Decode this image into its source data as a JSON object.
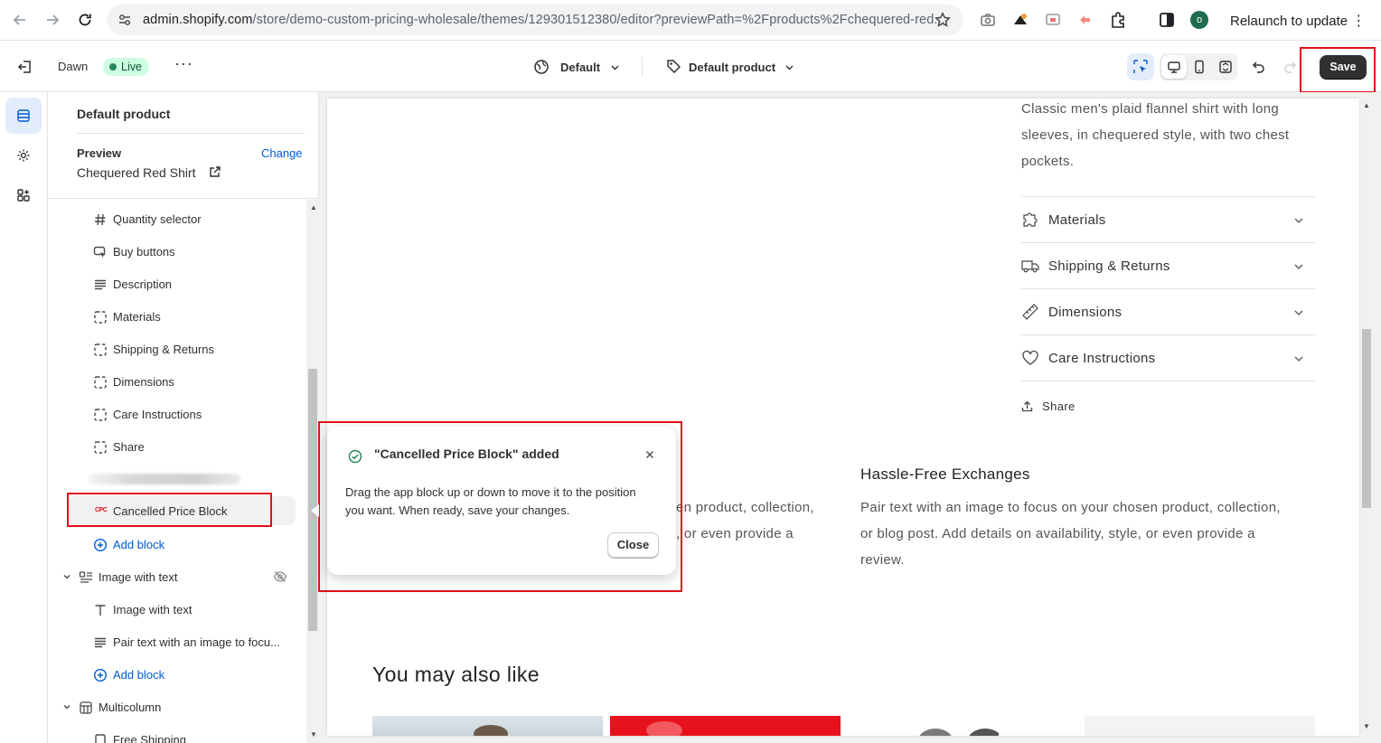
{
  "browser": {
    "url_host": "admin.shopify.com",
    "url_path": "/store/demo-custom-pricing-wholesale/themes/129301512380/editor?previewPath=%2Fproducts%2Fchequered-red...",
    "profile_initial": "o",
    "relaunch_label": "Relaunch to update"
  },
  "topbar": {
    "theme_name": "Dawn",
    "live_badge": "Live",
    "template_select": "Default",
    "product_select": "Default product",
    "save_label": "Save"
  },
  "sidebar": {
    "title": "Default product",
    "preview_label": "Preview",
    "change_link": "Change",
    "preview_product": "Chequered Red Shirt",
    "items": [
      {
        "label": "Quantity selector",
        "icon": "hash-icon"
      },
      {
        "label": "Buy buttons",
        "icon": "cursor-click-icon"
      },
      {
        "label": "Description",
        "icon": "text-align-icon"
      },
      {
        "label": "Materials",
        "icon": "dashed-square-icon"
      },
      {
        "label": "Shipping & Returns",
        "icon": "dashed-square-icon"
      },
      {
        "label": "Dimensions",
        "icon": "dashed-square-icon"
      },
      {
        "label": "Care Instructions",
        "icon": "dashed-square-icon"
      },
      {
        "label": "Share",
        "icon": "dashed-square-icon"
      }
    ],
    "app_block_label": "Cancelled Price Block",
    "app_block_badge": "CPC",
    "add_block_1": "Add block",
    "section_image_with_text": "Image with text",
    "iwt_children": [
      {
        "label": "Image with text",
        "icon": "text-T-icon"
      },
      {
        "label": "Pair text with an image to focu...",
        "icon": "text-align-icon"
      }
    ],
    "add_block_2": "Add block",
    "section_multicolumn": "Multicolumn",
    "multicolumn_child": "Free Shipping"
  },
  "preview": {
    "description": [
      "Classic men's plaid flannel shirt with long",
      "sleeves, in chequered style, with two chest",
      "pockets."
    ],
    "accordions": [
      {
        "label": "Materials",
        "icon": "puzzle-icon"
      },
      {
        "label": "Shipping & Returns",
        "icon": "truck-icon"
      },
      {
        "label": "Dimensions",
        "icon": "ruler-icon"
      },
      {
        "label": "Care Instructions",
        "icon": "heart-icon"
      }
    ],
    "share_label": "Share",
    "col2_heading": "Hassle-Free Exchanges",
    "col2_lines": [
      "Pair text with an image to focus on your chosen product, collection,",
      "or blog post. Add details on availability, style, or even provide a",
      "review."
    ],
    "col1_lines": [
      "en product, collection,",
      ", or even provide a"
    ],
    "related_heading": "You may also like"
  },
  "toast": {
    "title": "\"Cancelled Price Block\" added",
    "body_line1": "Drag the app block up or down to move it to the position",
    "body_line2": "you want. When ready, save your changes.",
    "close_label": "Close"
  },
  "colors": {
    "highlight_red": "#e0101b",
    "link_blue": "#005bd3",
    "live_green": "#29845a",
    "save_dark": "#303030"
  }
}
